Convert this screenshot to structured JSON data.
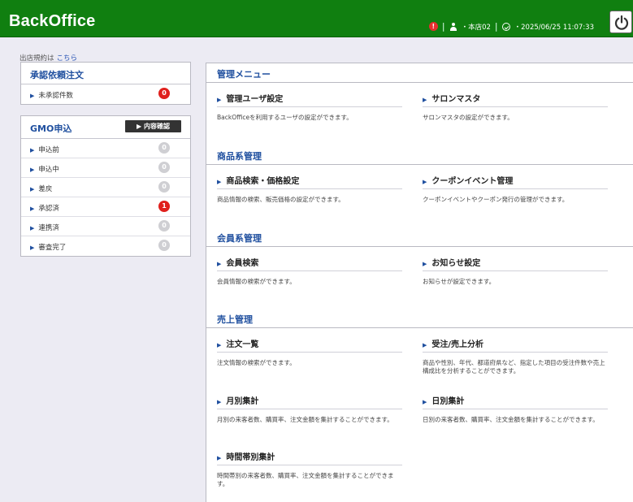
{
  "header": {
    "brand": "BackOffice",
    "alert_count": "!",
    "user": "・本店02",
    "datetime": "・2025/06/25 11:07:33"
  },
  "store_rules": {
    "prefix": "出店規約は",
    "link": "こちら"
  },
  "approval_panel": {
    "title": "承認依頼注文",
    "rows": [
      {
        "label": "未承認件数",
        "count": "0",
        "highlight": true
      }
    ]
  },
  "gmo_panel": {
    "title": "GMO申込",
    "detail_button": "▶ 内容確認",
    "rows": [
      {
        "label": "申込前",
        "count": "0",
        "highlight": false
      },
      {
        "label": "申込中",
        "count": "0",
        "highlight": false
      },
      {
        "label": "差戻",
        "count": "0",
        "highlight": false
      },
      {
        "label": "承認済",
        "count": "1",
        "highlight": true
      },
      {
        "label": "連携済",
        "count": "0",
        "highlight": false
      },
      {
        "label": "審査完了",
        "count": "0",
        "highlight": false
      }
    ]
  },
  "sections": {
    "admin": {
      "title": "管理メニュー",
      "items": [
        {
          "title": "管理ユーザ設定",
          "desc": "BackOfficeを利用するユーザの設定ができます。"
        },
        {
          "title": "サロンマスタ",
          "desc": "サロンマスタの設定ができます。"
        }
      ]
    },
    "product": {
      "title": "商品系管理",
      "items": [
        {
          "title": "商品検索・価格設定",
          "desc": "商品情報の検索、販売価格の設定ができます。"
        },
        {
          "title": "クーポンイベント管理",
          "desc": "クーポンイベントやクーポン発行の管理ができます。"
        }
      ]
    },
    "member": {
      "title": "会員系管理",
      "items": [
        {
          "title": "会員検索",
          "desc": "会員情報の検索ができます。"
        },
        {
          "title": "お知らせ設定",
          "desc": "お知らせが設定できます。"
        }
      ]
    },
    "sales": {
      "title": "売上管理",
      "items": [
        {
          "title": "注文一覧",
          "desc": "注文情報の検索ができます。"
        },
        {
          "title": "受注/売上分析",
          "desc": "商品や性別、年代、都道府県など、指定した項目の受注件数や売上構成比を分析することができます。"
        },
        {
          "title": "月別集計",
          "desc": "月別の来客者数、購買率、注文金額を集計することができます。"
        },
        {
          "title": "日別集計",
          "desc": "日別の来客者数、購買率、注文金額を集計することができます。"
        },
        {
          "title": "時間帯別集計",
          "desc": "時間帯別の来客者数、購買率、注文金額を集計することができます。"
        }
      ]
    }
  }
}
